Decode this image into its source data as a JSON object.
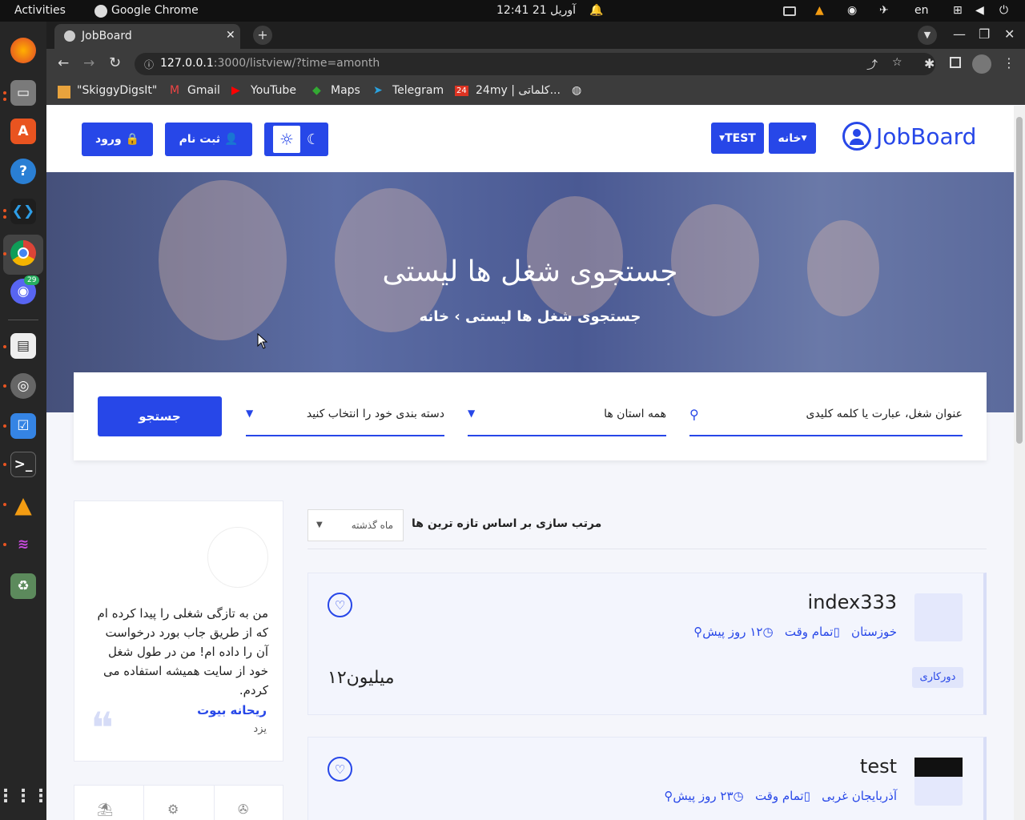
{
  "system": {
    "activities": "Activities",
    "app": "Google Chrome",
    "datetime": "آوریل 21  12:41",
    "lang": "en",
    "dock_badge": "29"
  },
  "browser": {
    "tab_title": "JobBoard",
    "url_host": "127.0.0.1",
    "url_rest": ":3000/listview/?time=amonth"
  },
  "bookmarks": [
    "\"SkiggyDigsIt\"",
    "Gmail",
    "YouTube",
    "Maps",
    "Telegram",
    "24my | کلماتی..."
  ],
  "nav": {
    "logo": "JobBoard",
    "home": "خانه",
    "test": "TEST",
    "register": "ثبت نام",
    "login": "ورود"
  },
  "hero": {
    "title": "جستجوی شغل ها لیستی",
    "crumb_home": "خانه",
    "crumb_sep": "›",
    "crumb_current": "جستجوی شغل ها لیستی"
  },
  "search": {
    "keyword_placeholder": "عنوان شغل، عبارت یا کلمه کلیدی",
    "province": "همه استان ها",
    "category": "دسته بندی خود را انتخاب کنید",
    "submit": "جستجو"
  },
  "sort": {
    "label": "مرتب سازی بر اساس تازه ترین ها",
    "selected": "ماه گذشته"
  },
  "jobs": [
    {
      "title": "index333",
      "location": "خوزستان",
      "type": "تمام وقت",
      "posted": "۱۲ روز پیش",
      "badge": "دورکاری",
      "salary": "۱۲میلیون"
    },
    {
      "title": "test",
      "location": "آذربایجان غربی",
      "type": "تمام وقت",
      "posted": "۲۳ روز پیش"
    }
  ],
  "testimonial": {
    "text": "من به تازگی شغلی را پیدا کرده ام که از طریق جاب بورد درخواست آن را داده ام! من در طول شغل خود از سایت همیشه استفاده می کردم.",
    "name": "ریحانه بیوت",
    "city": "یزد"
  }
}
